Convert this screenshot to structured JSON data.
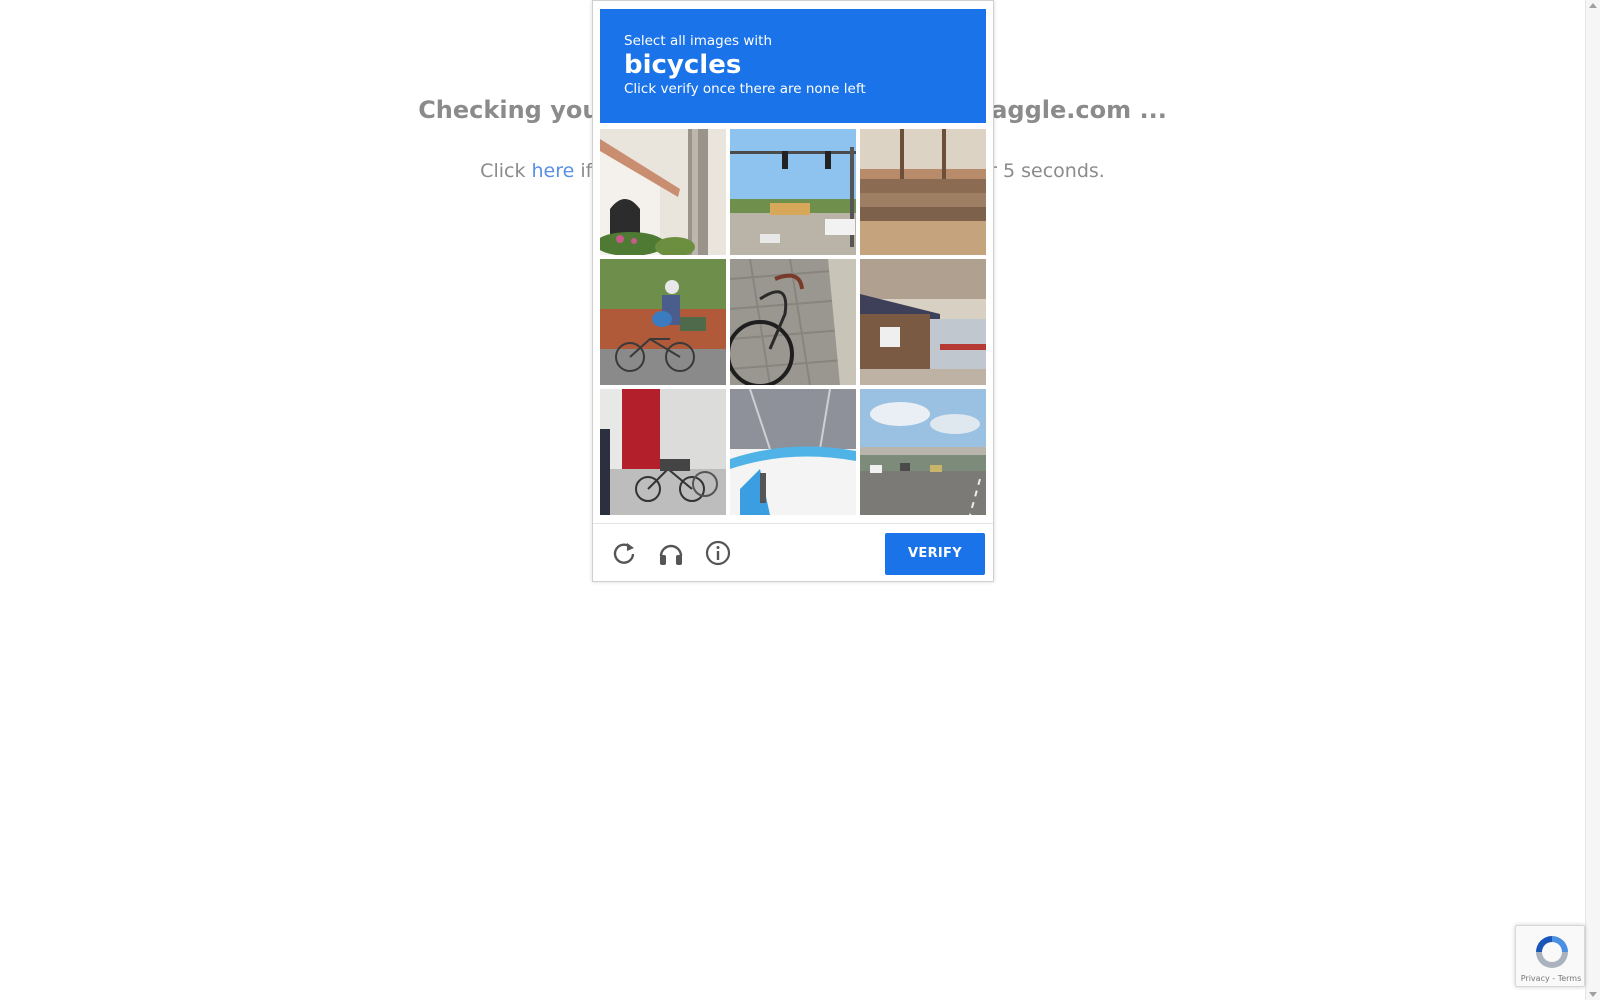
{
  "background": {
    "title": "Checking your browser before accessing kaggle.com ...",
    "click_prefix": "Click ",
    "click_link": "here",
    "click_suffix": " if you are not automatically redirected after 5 seconds."
  },
  "captcha": {
    "line1": "Select all images with",
    "target": "bicycles",
    "line3": "Click verify once there are none left",
    "verify_label": "VERIFY",
    "tiles": [
      "house-with-tree",
      "traffic-light-street",
      "wooden-boat",
      "person-riding-bicycle",
      "bicycle-wheel-on-pavement",
      "storefront",
      "bicycles-parked-by-red-door",
      "bicycle-closeup-street",
      "highway-overpass"
    ],
    "icons": [
      "reload-icon",
      "headphones-icon",
      "info-icon"
    ],
    "header_color": "#1a73e8"
  },
  "badge": {
    "privacy": "Privacy",
    "separator": " - ",
    "terms": "Terms"
  }
}
